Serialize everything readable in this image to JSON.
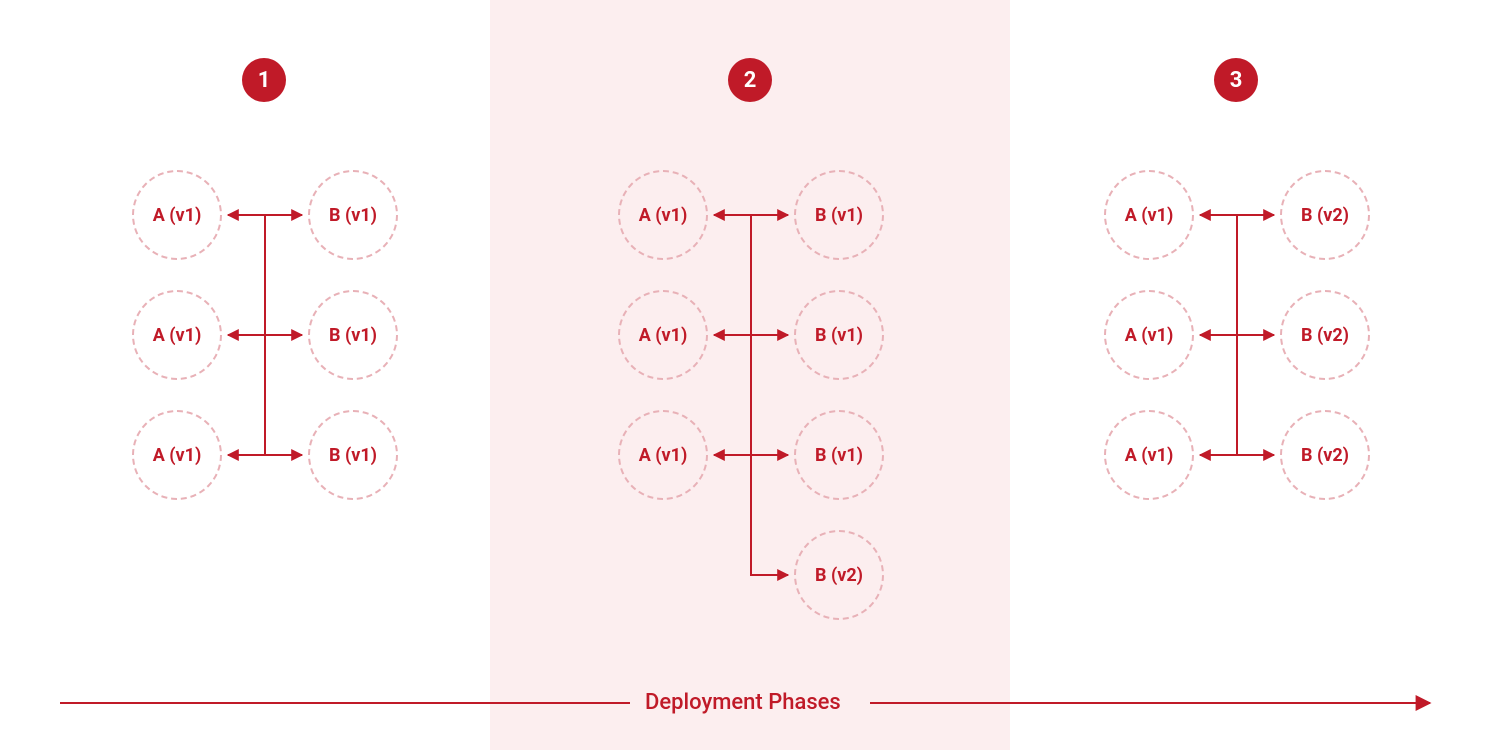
{
  "colors": {
    "accent": "#c01a28",
    "highlight_bg": "#fceeef",
    "node_border": "#e8b1b7"
  },
  "footer_label": "Deployment Phases",
  "phases": [
    {
      "badge": "1",
      "left": [
        "A (v1)",
        "A (v1)",
        "A (v1)"
      ],
      "right": [
        "B (v1)",
        "B (v1)",
        "B (v1)"
      ]
    },
    {
      "badge": "2",
      "left": [
        "A (v1)",
        "A (v1)",
        "A (v1)"
      ],
      "right": [
        "B (v1)",
        "B (v1)",
        "B (v1)",
        "B (v2)"
      ]
    },
    {
      "badge": "3",
      "left": [
        "A (v1)",
        "A (v1)",
        "A (v1)"
      ],
      "right": [
        "B (v2)",
        "B (v2)",
        "B (v2)"
      ]
    }
  ]
}
